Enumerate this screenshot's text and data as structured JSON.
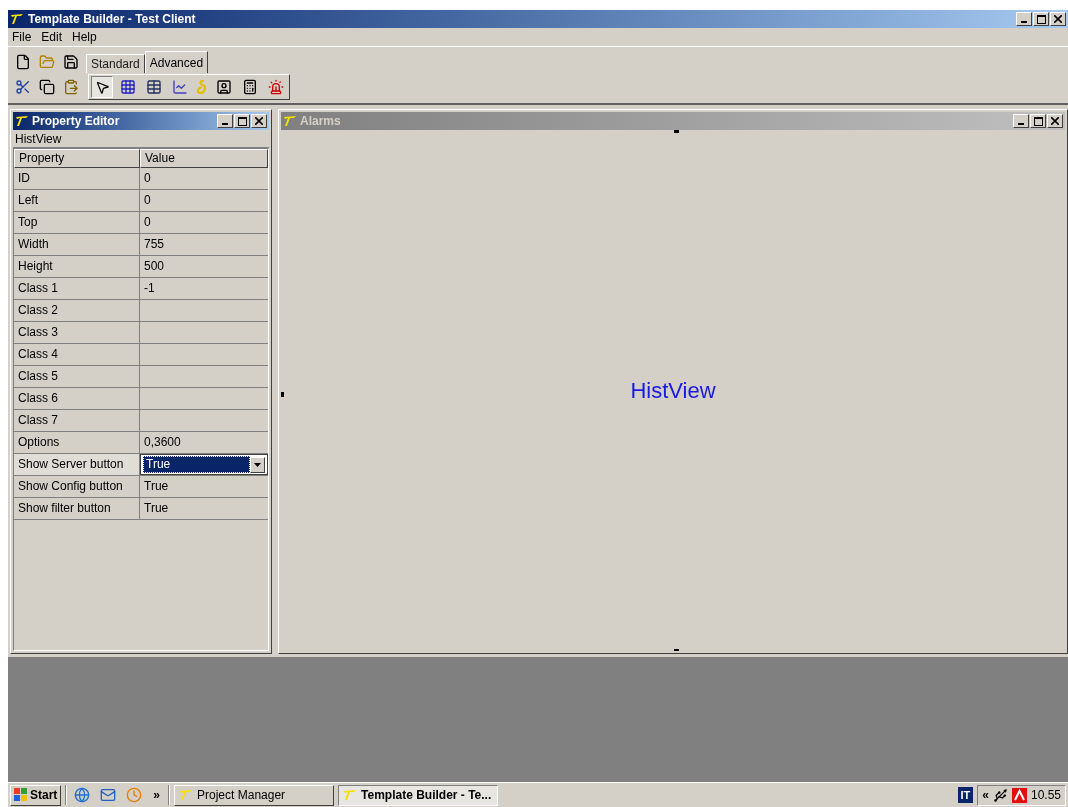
{
  "window": {
    "title": "Template Builder - Test Client"
  },
  "menu": [
    "File",
    "Edit",
    "Help"
  ],
  "toolbar_tabs": [
    {
      "label": "Standard",
      "selected": false
    },
    {
      "label": "Advanced",
      "selected": true
    }
  ],
  "property_editor": {
    "title": "Property Editor",
    "active": true,
    "object": "HistView",
    "columns": [
      "Property",
      "Value"
    ],
    "rows": [
      {
        "property": "ID",
        "value": "0",
        "selected": false
      },
      {
        "property": "Left",
        "value": "0",
        "selected": false
      },
      {
        "property": "Top",
        "value": "0",
        "selected": false
      },
      {
        "property": "Width",
        "value": "755",
        "selected": false
      },
      {
        "property": "Height",
        "value": "500",
        "selected": false
      },
      {
        "property": "Class 1",
        "value": "-1",
        "selected": false
      },
      {
        "property": "Class 2",
        "selected": false
      },
      {
        "property": "Class 3",
        "selected": false
      },
      {
        "property": "Class 4",
        "selected": false
      },
      {
        "property": "Class 5",
        "selected": false
      },
      {
        "property": "Class 6",
        "selected": false
      },
      {
        "property": "Class 7",
        "selected": false
      },
      {
        "property": "Options",
        "value": "0,3600",
        "selected": false
      },
      {
        "property": "Show Server button",
        "value": "True",
        "selected": true
      },
      {
        "property": "Show Config button",
        "value": "True",
        "selected": false
      },
      {
        "property": "Show filter button",
        "value": "True",
        "selected": false
      }
    ]
  },
  "alarms": {
    "title": "Alarms",
    "active": false,
    "content": "HistView"
  },
  "taskbar": {
    "start": "Start",
    "chevron": "»",
    "items": [
      {
        "label": "Project Manager",
        "selected": false
      },
      {
        "label": "Template Builder - Te...",
        "selected": true
      }
    ],
    "language": "IT",
    "tray_chevron": "«",
    "clock": "10.55"
  }
}
